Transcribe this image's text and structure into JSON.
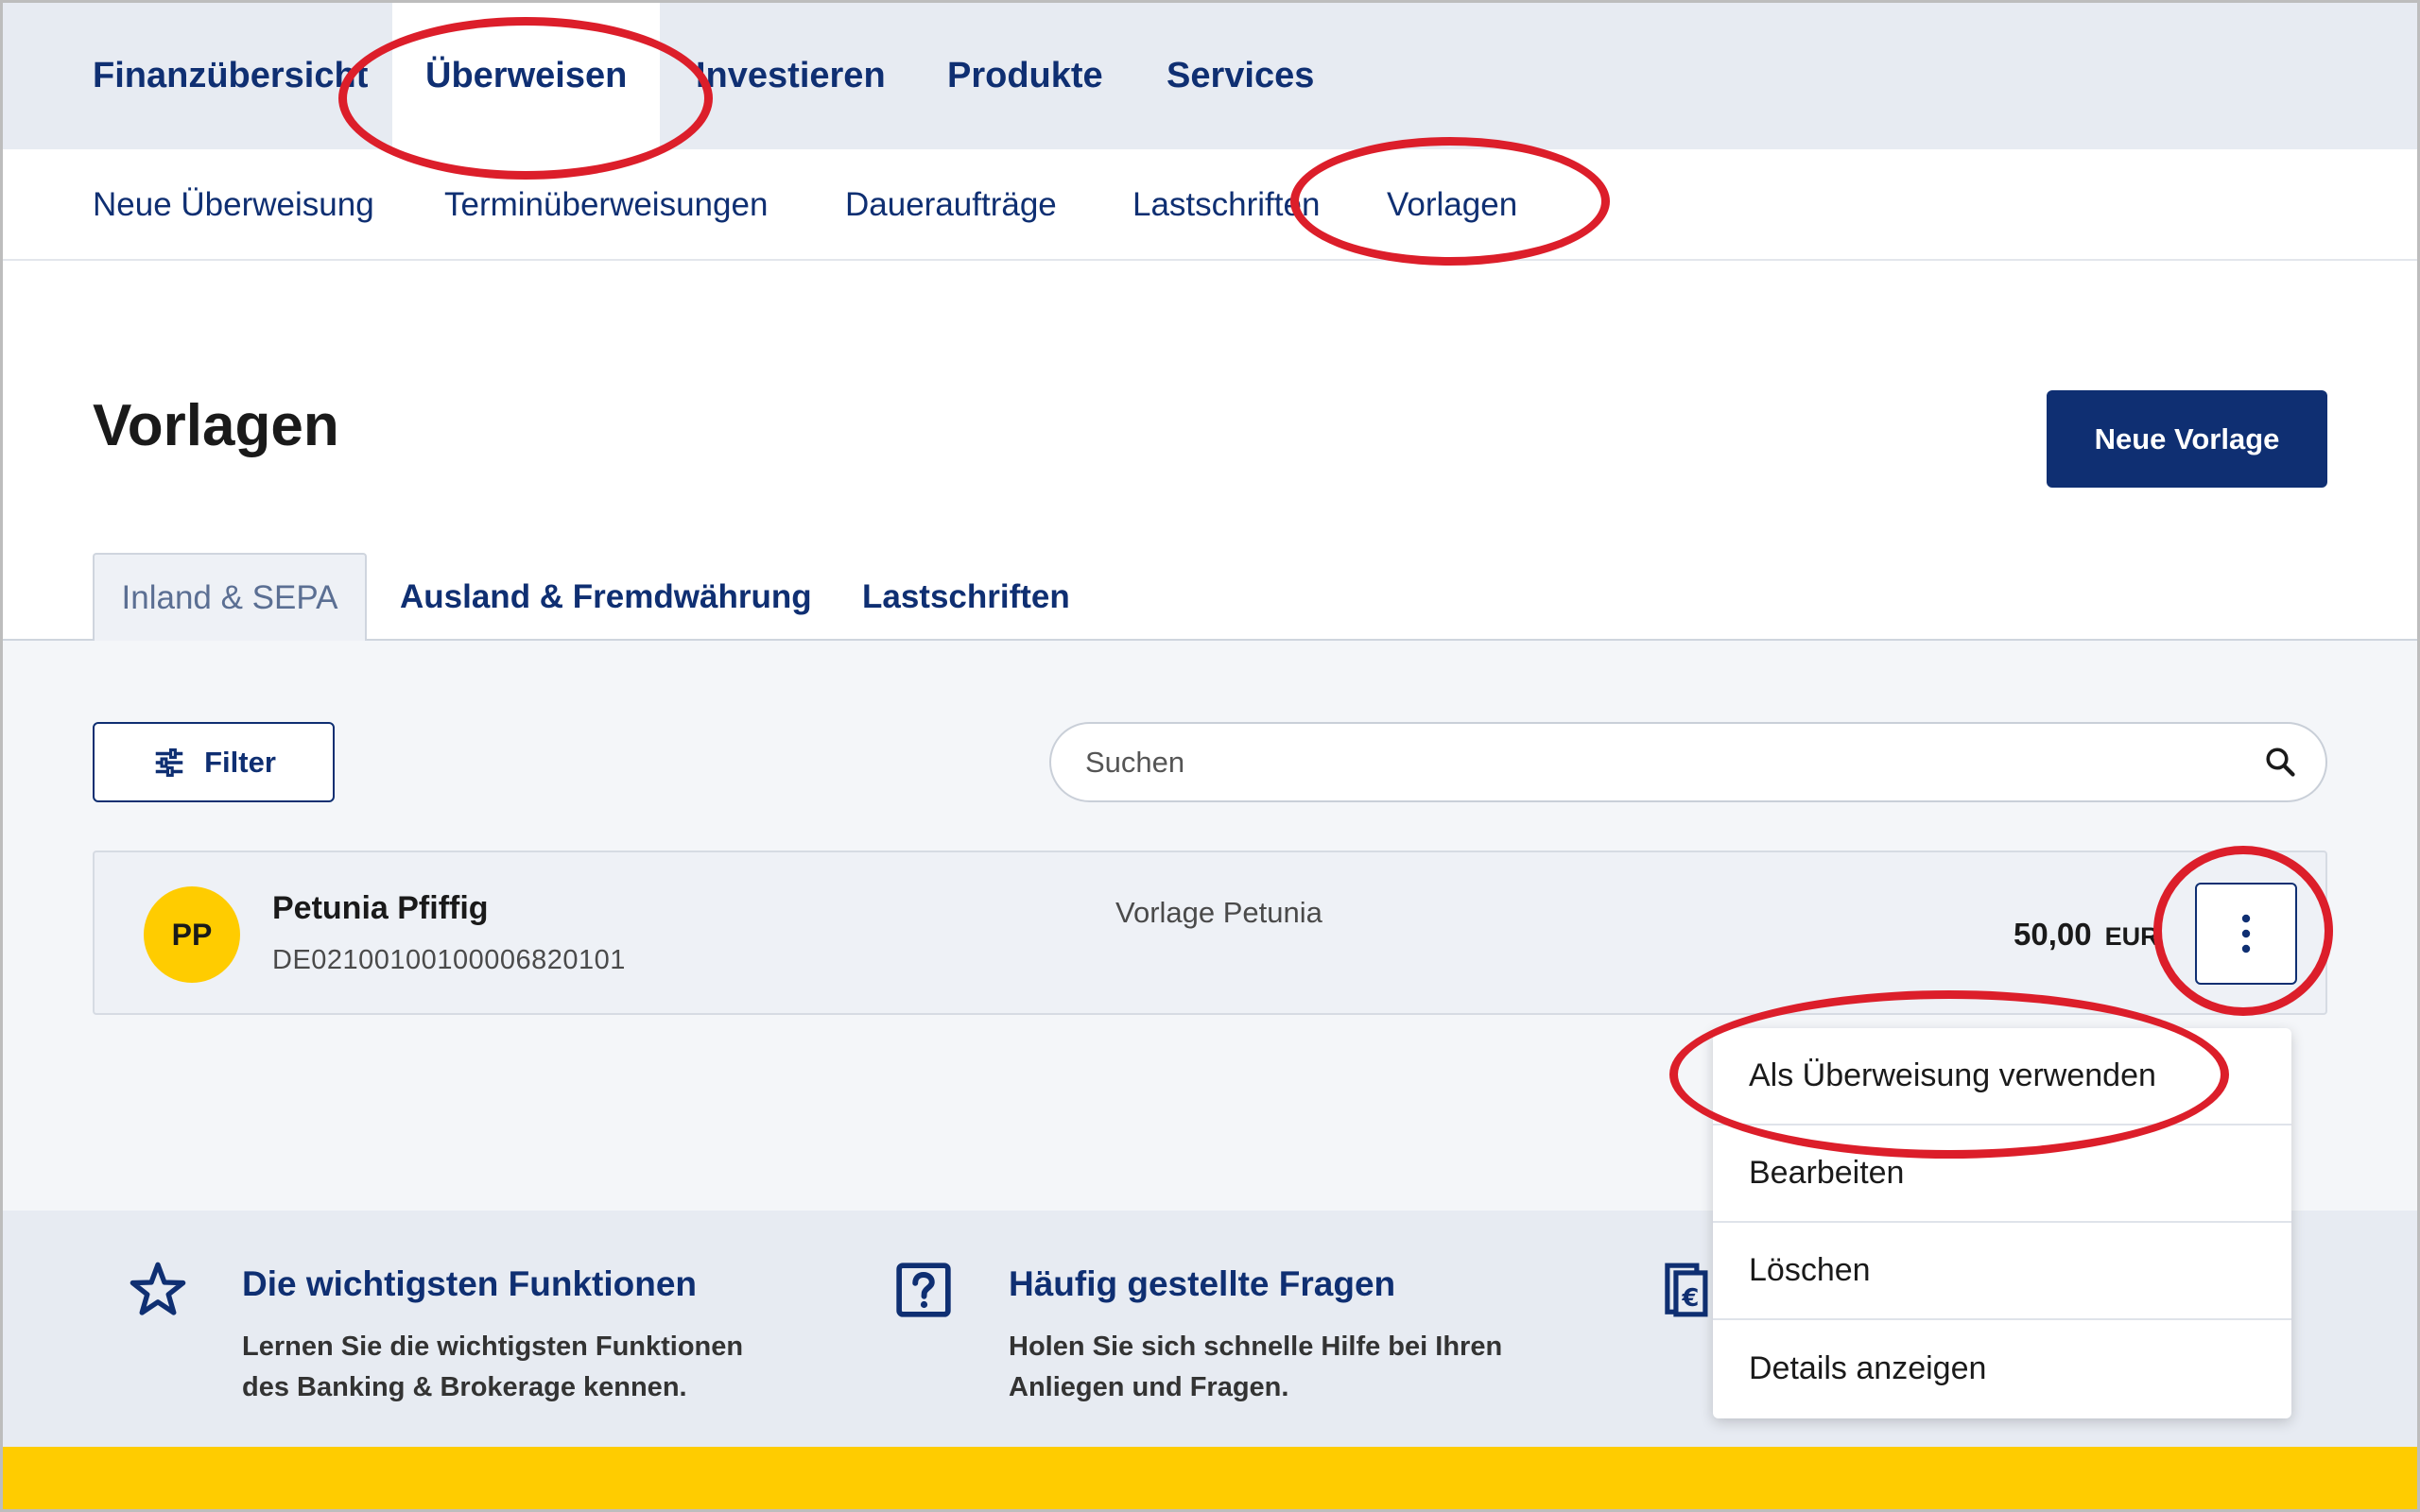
{
  "topnav": {
    "items": [
      "Finanzübersicht",
      "Überweisen",
      "Investieren",
      "Produkte",
      "Services"
    ]
  },
  "subnav": {
    "items": [
      "Neue Überweisung",
      "Terminüberweisungen",
      "Daueraufträge",
      "Lastschriften",
      "Vorlagen"
    ]
  },
  "page": {
    "title": "Vorlagen",
    "new_button": "Neue Vorlage"
  },
  "tabs": [
    "Inland & SEPA",
    "Ausland & Fremdwährung",
    "Lastschriften"
  ],
  "filter": {
    "label": "Filter"
  },
  "search": {
    "placeholder": "Suchen"
  },
  "template_row": {
    "initials": "PP",
    "name": "Petunia Pfiffig",
    "iban": "DE02100100100006820101",
    "description": "Vorlage Petunia",
    "amount": "50,00",
    "currency": "EUR"
  },
  "menu": {
    "items": [
      "Als Überweisung verwenden",
      "Bearbeiten",
      "Löschen",
      "Details anzeigen"
    ]
  },
  "info": {
    "functions": {
      "title": "Die wichtigsten Funktionen",
      "line1": "Lernen Sie die wichtigsten Funktionen",
      "line2": "des Banking & Brokerage kennen."
    },
    "faq": {
      "title": "Häufig gestellte Fragen",
      "line1": "Holen Sie sich schnelle Hilfe bei Ihren",
      "line2": "Anliegen und Fragen."
    }
  },
  "colors": {
    "brand_blue": "#0f2f72",
    "brand_yellow": "#ffcc00",
    "annotation_red": "#dc1e2a"
  }
}
